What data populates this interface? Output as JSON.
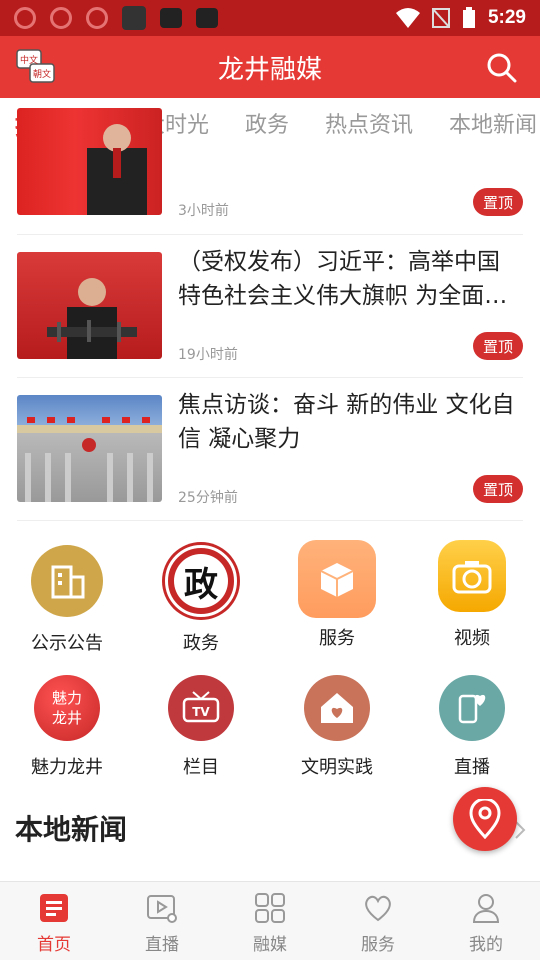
{
  "status_bar": {
    "time": "5:29"
  },
  "header": {
    "title": "龙井融媒",
    "lang_top": "中文",
    "lang_bottom": "朝文"
  },
  "tabs": [
    {
      "label": "推荐",
      "active": true
    },
    {
      "label": "二十大时光"
    },
    {
      "label": "政务"
    },
    {
      "label": "热点资讯"
    },
    {
      "label": "本地新闻"
    }
  ],
  "news": [
    {
      "title": "",
      "time": "3小时前",
      "badge": "置顶"
    },
    {
      "title": "（受权发布）习近平：高举中国特色社会主义伟大旗帜 为全面…",
      "time": "19小时前",
      "badge": "置顶"
    },
    {
      "title": "焦点访谈：奋斗 新的伟业 文化自信 凝心聚力",
      "time": "25分钟前",
      "badge": "置顶"
    }
  ],
  "grid": [
    {
      "label": "公示公告",
      "icon": "building-icon",
      "color": "#cfa74a"
    },
    {
      "label": "政务",
      "icon": "zheng-icon",
      "glyph": "政",
      "color": "#c62828"
    },
    {
      "label": "服务",
      "icon": "box-icon",
      "color": "#ffb27a"
    },
    {
      "label": "视频",
      "icon": "camera-icon",
      "color": "#f5b820"
    },
    {
      "label": "魅力龙井",
      "icon": "charm-icon",
      "glyph_top": "魅力",
      "glyph_bottom": "龙井",
      "color": "#d32f2f"
    },
    {
      "label": "栏目",
      "icon": "tv-icon",
      "glyph": "TV",
      "color": "#c0393d"
    },
    {
      "label": "文明实践",
      "icon": "house-heart-icon",
      "color": "#c8735a"
    },
    {
      "label": "直播",
      "icon": "phone-heart-icon",
      "color": "#6aa8a6"
    }
  ],
  "section": {
    "title": "本地新闻"
  },
  "bottom_nav": [
    {
      "label": "首页",
      "icon": "home-icon",
      "active": true
    },
    {
      "label": "直播",
      "icon": "live-icon"
    },
    {
      "label": "融媒",
      "icon": "grid-icon"
    },
    {
      "label": "服务",
      "icon": "heart-icon"
    },
    {
      "label": "我的",
      "icon": "user-icon"
    }
  ],
  "colors": {
    "primary": "#e53935",
    "status_bar": "#b71c1c",
    "badge": "#d32f2f"
  }
}
